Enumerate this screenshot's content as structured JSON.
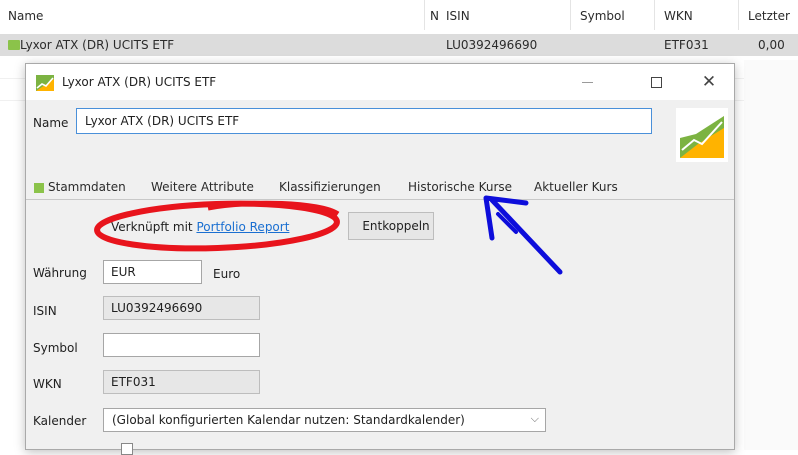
{
  "table": {
    "headers": [
      "Name",
      "N",
      "ISIN",
      "Symbol",
      "WKN",
      "Letzter"
    ],
    "row": {
      "name": "Lyxor ATX (DR) UCITS ETF",
      "isin": "LU0392496690",
      "wkn": "ETF031",
      "last": "0,00"
    }
  },
  "dialog": {
    "title": "Lyxor ATX (DR) UCITS ETF",
    "close_glyph": "✕",
    "name_label": "Name",
    "name_value": "Lyxor ATX (DR) UCITS ETF",
    "tabs": [
      "Stammdaten",
      "Weitere Attribute",
      "Klassifizierungen",
      "Historische Kurse",
      "Aktueller Kurs"
    ],
    "linked_prefix": "Verknüpft mit ",
    "linked_link": "Portfolio Report",
    "unlink_button": "Entkoppeln",
    "fields": {
      "currency_label": "Währung",
      "currency_value": "EUR",
      "currency_name": "Euro",
      "isin_label": "ISIN",
      "isin_value": "LU0392496690",
      "symbol_label": "Symbol",
      "symbol_value": "",
      "wkn_label": "WKN",
      "wkn_value": "ETF031",
      "calendar_label": "Kalender",
      "calendar_value": "(Global konfigurierten Kalendar nutzen: Standardkalender)"
    },
    "chevron_glyph": "⌵"
  },
  "colors": {
    "accent_link": "#1a6fd1",
    "annotation_red": "#e8141c",
    "annotation_blue": "#0d0ddb",
    "selected_row": "#dcdcdc",
    "icon_green": "#8bc34a"
  }
}
